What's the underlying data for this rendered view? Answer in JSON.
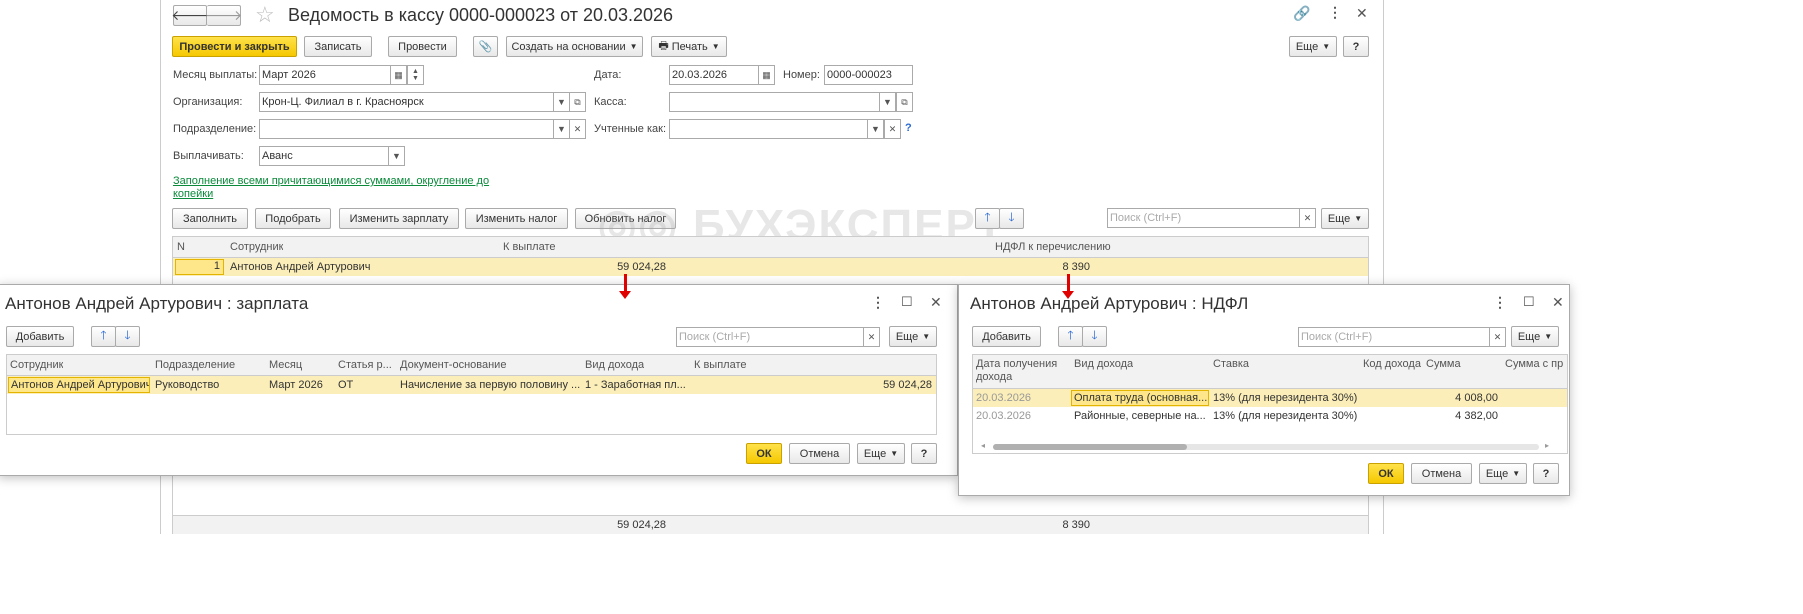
{
  "main": {
    "title": "Ведомость в кассу 0000-000023 от 20.03.2026",
    "toolbar": {
      "post_close": "Провести и закрыть",
      "save": "Записать",
      "post": "Провести",
      "create_based": "Создать на основании",
      "print": "Печать",
      "more": "Еще",
      "help": "?"
    },
    "form": {
      "month_label": "Месяц выплаты:",
      "month_value": "Март 2026",
      "date_label": "Дата:",
      "date_value": "20.03.2026",
      "number_label": "Номер:",
      "number_value": "0000-000023",
      "org_label": "Организация:",
      "org_value": "Крон-Ц. Филиал в г. Красноярск",
      "cash_label": "Касса:",
      "cash_value": "",
      "dept_label": "Подразделение:",
      "dept_value": "",
      "accounted_label": "Учтенные как:",
      "accounted_value": "",
      "pay_label": "Выплачивать:",
      "pay_value": "Аванс",
      "fill_link_line1": "Заполнение всеми причитающимися суммами, округление до",
      "fill_link_line2": "копейки"
    },
    "table_toolbar": {
      "fill": "Заполнить",
      "pick": "Подобрать",
      "change_salary": "Изменить зарплату",
      "change_tax": "Изменить налог",
      "refresh_tax": "Обновить налог",
      "search_placeholder": "Поиск (Ctrl+F)",
      "more": "Еще"
    },
    "table": {
      "headers": [
        "N",
        "Сотрудник",
        "К выплате",
        "НДФЛ к перечислению"
      ],
      "rows": [
        [
          "1",
          "Антонов Андрей Артурович",
          "59 024,28",
          "8 390"
        ]
      ],
      "totals": [
        "59 024,28",
        "8 390"
      ]
    },
    "watermark": "БУХЭКСПЕРТ"
  },
  "salary_dialog": {
    "title": "Антонов Андрей Артурович : зарплата",
    "add": "Добавить",
    "search_placeholder": "Поиск (Ctrl+F)",
    "more": "Еще",
    "headers": [
      "Сотрудник",
      "Подразделение",
      "Месяц",
      "Статья р...",
      "Документ-основание",
      "Вид дохода",
      "К выплате"
    ],
    "rows": [
      [
        "Антонов Андрей Артурович",
        "Руководство",
        "Март 2026",
        "ОТ",
        "Начисление за первую половину ...",
        "1 - Заработная пл...",
        "59 024,28"
      ]
    ],
    "ok": "ОК",
    "cancel": "Отмена",
    "help": "?"
  },
  "ndfl_dialog": {
    "title": "Антонов Андрей Артурович : НДФЛ",
    "add": "Добавить",
    "search_placeholder": "Поиск (Ctrl+F)",
    "more": "Еще",
    "headers": [
      "Дата получения дохода",
      "Вид дохода",
      "Ставка",
      "Код дохода",
      "Сумма",
      "Сумма с пр"
    ],
    "rows": [
      [
        "20.03.2026",
        "Оплата труда (основная...",
        "13% (для нерезидента 30%)",
        "",
        "4 008,00"
      ],
      [
        "20.03.2026",
        "Районные, северные на...",
        "13% (для нерезидента 30%)",
        "",
        "4 382,00"
      ]
    ],
    "ok": "ОК",
    "cancel": "Отмена",
    "help": "?"
  }
}
